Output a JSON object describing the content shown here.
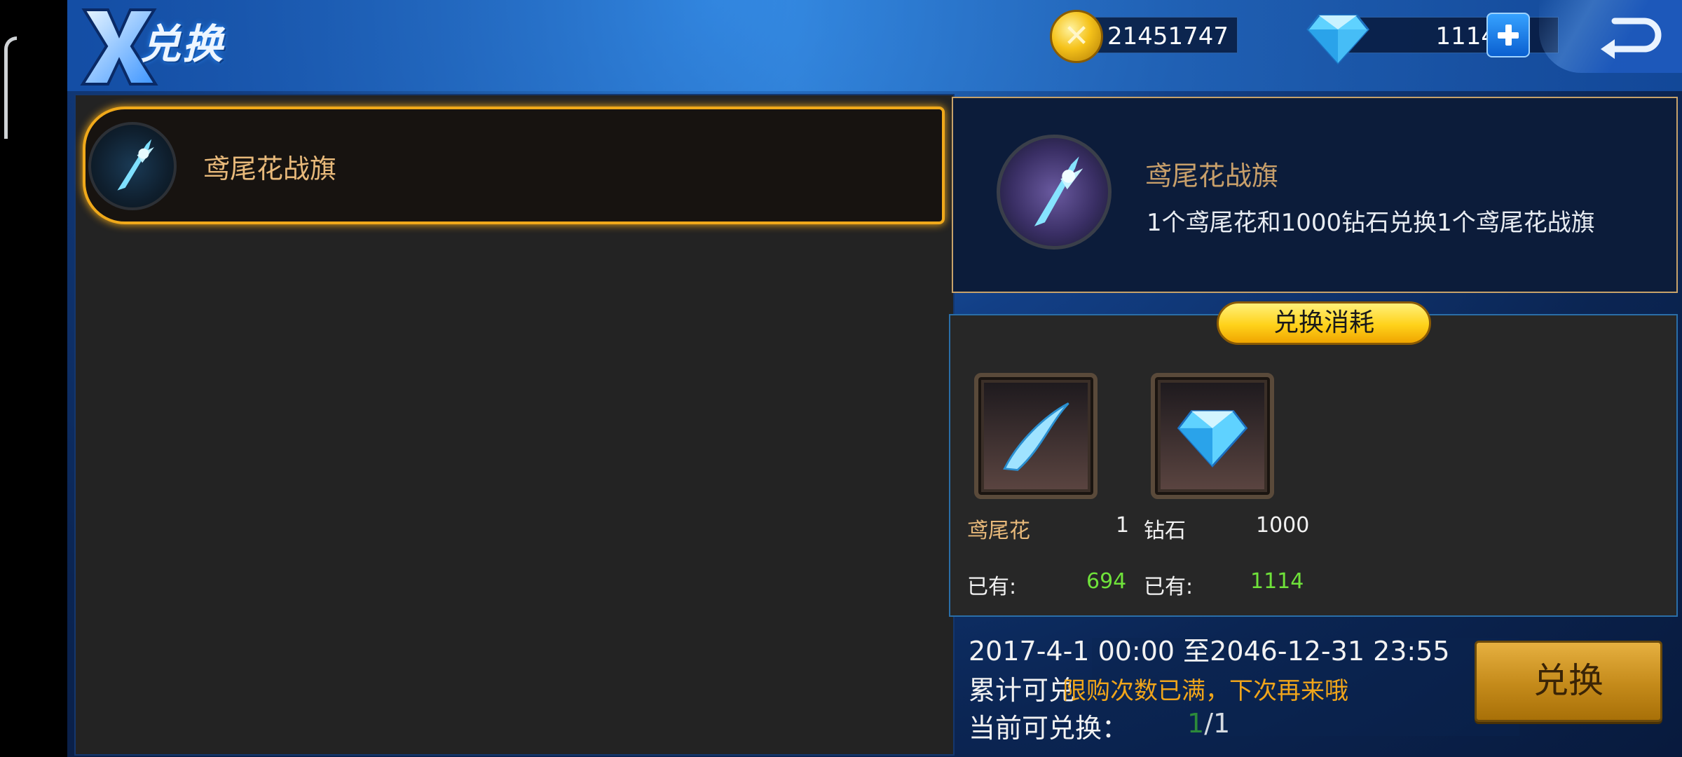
{
  "header": {
    "title": "兑换",
    "gold_amount": "21451747",
    "diamond_amount": "1114"
  },
  "list": {
    "items": [
      {
        "name": "鸢尾花战旗",
        "selected": true
      }
    ]
  },
  "detail": {
    "name": "鸢尾花战旗",
    "description": "1个鸢尾花和1000钻石兑换1个鸢尾花战旗"
  },
  "cost": {
    "title": "兑换消耗",
    "materials": [
      {
        "name": "鸢尾花",
        "quantity": "1",
        "owned_label": "已有:",
        "owned": "694",
        "name_color": "#e8b97a"
      },
      {
        "name": "钻石",
        "quantity": "1000",
        "owned_label": "已有:",
        "owned": "1114",
        "name_color": "#f2f2f2"
      }
    ]
  },
  "info": {
    "date_range": "2017-4-1 00:00 至2046-12-31 23:55",
    "total_label": "累计可兑",
    "limit_message": "限购次数已满，下次再来哦",
    "current_label": "当前可兑换：",
    "current_count": "1",
    "current_max": "1"
  },
  "actions": {
    "exchange_label": "兑换"
  },
  "colors": {
    "accent_gold": "#f0a91a",
    "owned_green": "#6fe23a",
    "panel_dark": "#232323",
    "navy": "#0c1c3a"
  }
}
